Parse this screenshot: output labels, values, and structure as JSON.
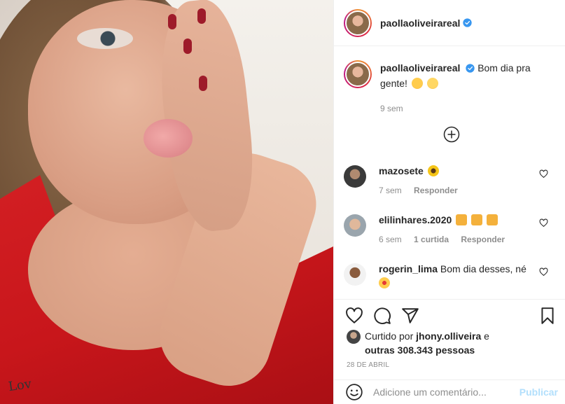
{
  "post": {
    "author": "paollaoliveirareal",
    "verified": true,
    "caption_text": "Bom dia pra gente!",
    "caption_emojis": [
      "smiling-face-with-hearts",
      "sleeping-face"
    ],
    "caption_age": "9 sem",
    "photo_tattoo": "Lov"
  },
  "load_more_icon": "plus-circle-icon",
  "comments": [
    {
      "user": "mazosete",
      "text": "",
      "emoji": "sunflower",
      "age": "7 sem",
      "reply_label": "Responder",
      "likes_label": ""
    },
    {
      "user": "elilinhares.2020",
      "text": "",
      "emoji": "raising-hands x3",
      "age": "6 sem",
      "likes_label": "1 curtida",
      "reply_label": "Responder"
    },
    {
      "user": "rogerin_lima",
      "text": "Bom dia desses, né",
      "emoji": "star-struck",
      "age": "",
      "reply_label": "",
      "likes_label": ""
    }
  ],
  "likes": {
    "prefix": "Curtido por",
    "user": "jhony.olliveira",
    "connector": "e",
    "others": "outras 308.343 pessoas"
  },
  "date": "28 DE ABRIL",
  "comment_box": {
    "placeholder": "Adicione um comentário...",
    "post_label": "Publicar"
  },
  "colors": {
    "verified_blue": "#3897f0",
    "link_disabled": "#b2dffc",
    "muted_text": "#8e8e8e"
  }
}
